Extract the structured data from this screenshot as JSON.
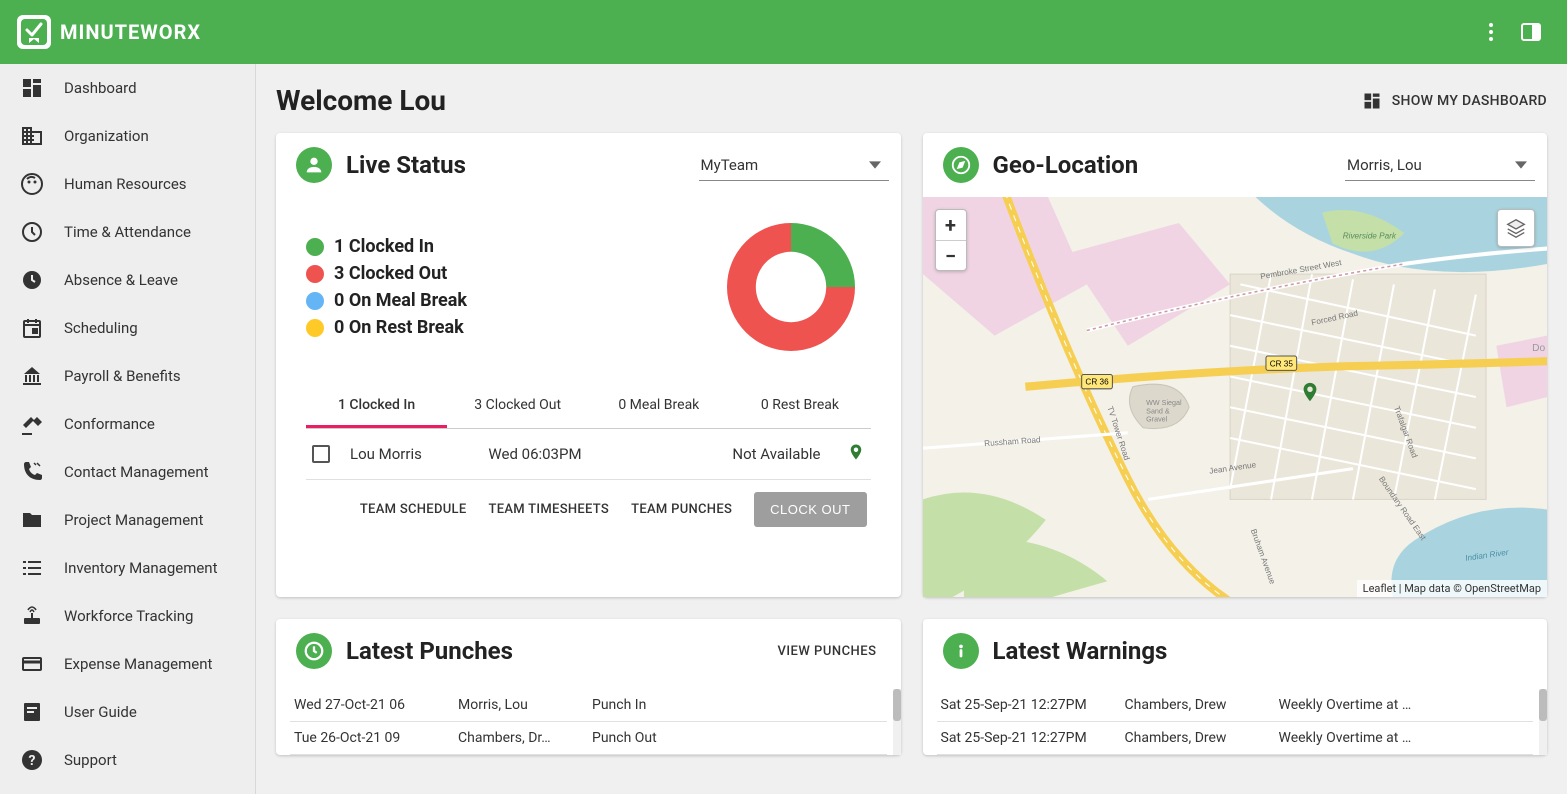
{
  "app": {
    "name": "MINUTEWORX"
  },
  "nav": [
    {
      "label": "Dashboard",
      "icon": "dashboard"
    },
    {
      "label": "Organization",
      "icon": "business"
    },
    {
      "label": "Human Resources",
      "icon": "face"
    },
    {
      "label": "Time & Attendance",
      "icon": "clock"
    },
    {
      "label": "Absence & Leave",
      "icon": "watch"
    },
    {
      "label": "Scheduling",
      "icon": "event"
    },
    {
      "label": "Payroll & Benefits",
      "icon": "bank"
    },
    {
      "label": "Conformance",
      "icon": "gavel"
    },
    {
      "label": "Contact Management",
      "icon": "phone"
    },
    {
      "label": "Project Management",
      "icon": "folder"
    },
    {
      "label": "Inventory Management",
      "icon": "list"
    },
    {
      "label": "Workforce Tracking",
      "icon": "router"
    },
    {
      "label": "Expense Management",
      "icon": "card"
    },
    {
      "label": "User Guide",
      "icon": "book"
    },
    {
      "label": "Support",
      "icon": "help"
    }
  ],
  "page": {
    "welcome": "Welcome Lou",
    "show_my_dashboard": "SHOW MY DASHBOARD"
  },
  "live": {
    "title": "Live Status",
    "filter": "MyTeam",
    "legend": [
      {
        "count": 1,
        "label": "Clocked In",
        "color": "#4caf50"
      },
      {
        "count": 3,
        "label": "Clocked Out",
        "color": "#ef5350"
      },
      {
        "count": 0,
        "label": "On Meal Break",
        "color": "#64b5f6"
      },
      {
        "count": 0,
        "label": "On Rest Break",
        "color": "#ffca28"
      }
    ],
    "tabs": [
      {
        "label": "1 Clocked In",
        "active": true
      },
      {
        "label": "3 Clocked Out",
        "active": false
      },
      {
        "label": "0 Meal Break",
        "active": false
      },
      {
        "label": "0 Rest Break",
        "active": false
      }
    ],
    "row": {
      "name": "Lou Morris",
      "time": "Wed 06:03PM",
      "status": "Not Available"
    },
    "actions": {
      "team_schedule": "TEAM SCHEDULE",
      "team_timesheets": "TEAM TIMESHEETS",
      "team_punches": "TEAM PUNCHES",
      "clock_out": "CLOCK OUT"
    }
  },
  "geo": {
    "title": "Geo-Location",
    "filter": "Morris, Lou",
    "attribution": "Leaflet | Map data © OpenStreetMap",
    "labels": {
      "riverside_park": "Riverside Park",
      "pembroke_st": "Pembroke Street West",
      "forced_rd": "Forced Road",
      "cr36": "CR 36",
      "cr35": "CR 35",
      "siegal": "WW Siegal Sand & Gravel",
      "tower_rd": "TV Tower Road",
      "jean_ave": "Jean Avenue",
      "russham": "Russham Road",
      "trafalgar": "Trafalgar Road",
      "boundary": "Boundary Road East",
      "bruham": "Bruham Avenue",
      "indian": "Indian River",
      "pembroke_city": "Do Pe"
    }
  },
  "punches": {
    "title": "Latest Punches",
    "link": "VIEW PUNCHES",
    "rows": [
      {
        "date": "Wed 27-Oct-21 06",
        "name": "Morris, Lou",
        "event": "Punch In"
      },
      {
        "date": "Tue 26-Oct-21 09",
        "name": "Chambers, Dr…",
        "event": "Punch Out"
      }
    ]
  },
  "warnings": {
    "title": "Latest Warnings",
    "rows": [
      {
        "date": "Sat 25-Sep-21 12:27PM",
        "name": "Chambers, Drew",
        "warn": "Weekly Overtime at …"
      },
      {
        "date": "Sat 25-Sep-21 12:27PM",
        "name": "Chambers, Drew",
        "warn": "Weekly Overtime at …"
      }
    ]
  },
  "chart_data": {
    "type": "pie",
    "title": "Live Status",
    "series": [
      {
        "name": "Clocked In",
        "value": 1,
        "color": "#4caf50"
      },
      {
        "name": "Clocked Out",
        "value": 3,
        "color": "#ef5350"
      },
      {
        "name": "On Meal Break",
        "value": 0,
        "color": "#64b5f6"
      },
      {
        "name": "On Rest Break",
        "value": 0,
        "color": "#ffca28"
      }
    ]
  }
}
